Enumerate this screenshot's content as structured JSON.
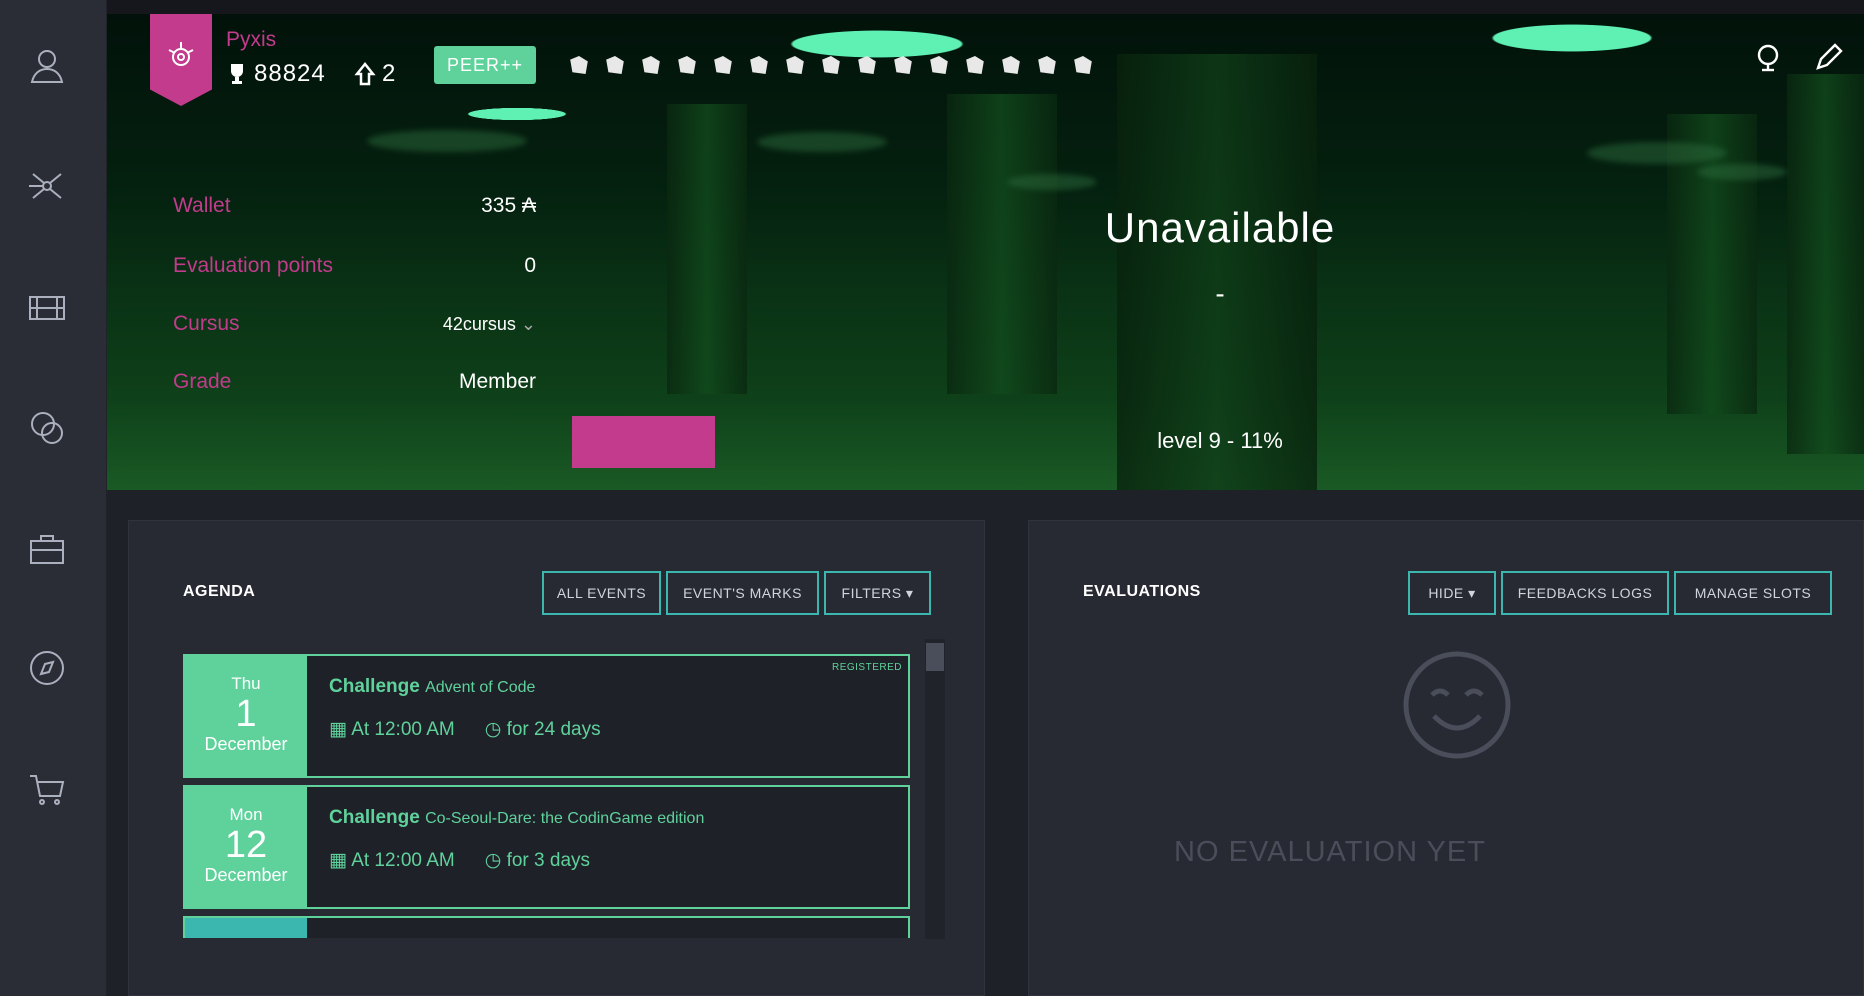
{
  "sidebar": {
    "items": [
      {
        "icon": "user-icon"
      },
      {
        "icon": "network-icon"
      },
      {
        "icon": "film-icon"
      },
      {
        "icon": "chat-icon"
      },
      {
        "icon": "briefcase-icon"
      },
      {
        "icon": "compass-icon"
      },
      {
        "icon": "cart-icon"
      }
    ]
  },
  "profile": {
    "username": "Pyxis",
    "trophy_score": "88824",
    "wallet_coins": "2",
    "peer_label": "PEER++"
  },
  "info": {
    "wallet_label": "Wallet",
    "wallet_value": "335",
    "wallet_symbol": "₳",
    "eval_label": "Evaluation points",
    "eval_value": "0",
    "cursus_label": "Cursus",
    "cursus_value": "42cursus",
    "grade_label": "Grade",
    "grade_value": "Member"
  },
  "status": {
    "title": "Unavailable",
    "subtitle": "-",
    "level": "level 9 - 11%"
  },
  "agenda": {
    "title": "AGENDA",
    "buttons": {
      "all": "ALL EVENTS",
      "marks": "EVENT'S MARKS",
      "filters": "FILTERS ▾"
    },
    "events": [
      {
        "dow": "Thu",
        "day": "1",
        "month": "December",
        "kind": "Challenge",
        "name": "Advent of Code",
        "time": "At 12:00 AM",
        "duration": "for 24 days",
        "tag": "REGISTERED"
      },
      {
        "dow": "Mon",
        "day": "12",
        "month": "December",
        "kind": "Challenge",
        "name": "Co-Seoul-Dare: the CodinGame edition",
        "time": "At 12:00 AM",
        "duration": "for 3 days",
        "tag": ""
      }
    ]
  },
  "evaluations": {
    "title": "EVALUATIONS",
    "buttons": {
      "hide": "HIDE ▾",
      "feedbacks": "FEEDBACKS LOGS",
      "slots": "MANAGE SLOTS"
    },
    "empty_text": "NO EVALUATION YET"
  },
  "colors": {
    "accent_pink": "#c23b8c",
    "accent_green": "#5fd29c",
    "accent_teal": "#3bb7b0"
  }
}
